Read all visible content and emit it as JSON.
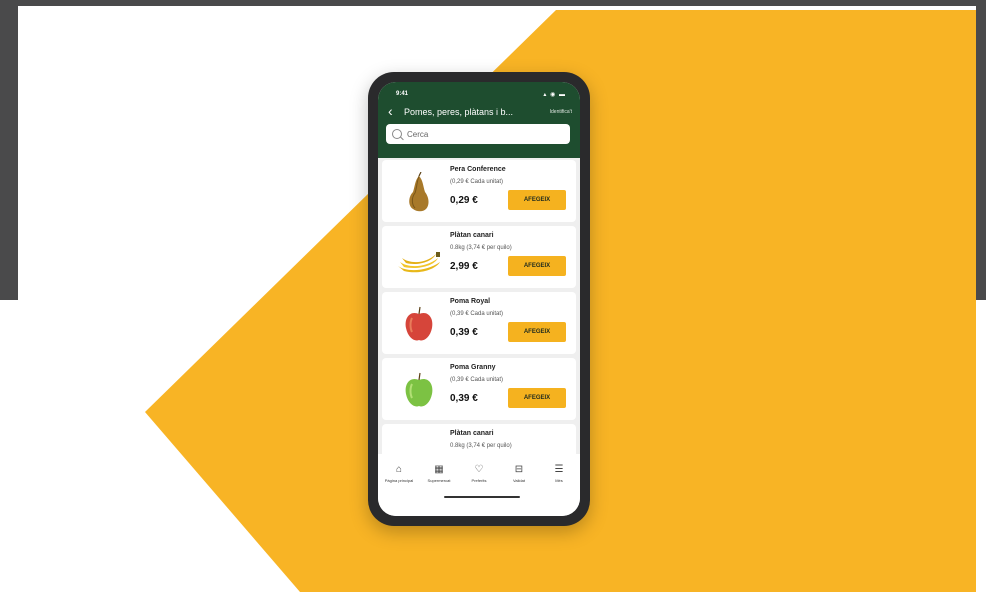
{
  "status_bar": {
    "time": "9:41",
    "icons": "▴ ◉ ▬"
  },
  "header": {
    "back_icon": "‹",
    "title": "Pomes, peres, plàtans i b...",
    "action": "Identifica't"
  },
  "search": {
    "icon": "search-icon",
    "placeholder": "Cerca"
  },
  "products": [
    {
      "name": "Pera Conference",
      "unit": "(0,29 € Cada unitat)",
      "price": "0,29 €",
      "button": "AFEGEIX",
      "image": "pear"
    },
    {
      "name": "Plàtan canari",
      "unit": "0.8kg (3,74 € per quilo)",
      "price": "2,99 €",
      "button": "AFEGEIX",
      "image": "bananas"
    },
    {
      "name": "Poma Royal",
      "unit": "(0,39 € Cada unitat)",
      "price": "0,39 €",
      "button": "AFEGEIX",
      "image": "red-apple"
    },
    {
      "name": "Poma Granny",
      "unit": "(0,39 € Cada unitat)",
      "price": "0,39 €",
      "button": "AFEGEIX",
      "image": "green-apple"
    },
    {
      "name": "Plàtan canari",
      "unit": "0.8kg (3,74 € per quilo)",
      "price": "",
      "button": "",
      "image": "bananas"
    }
  ],
  "tabs": [
    {
      "label": "Pàgina principal",
      "icon": "home-icon"
    },
    {
      "label": "Supermercat",
      "icon": "grid-icon"
    },
    {
      "label": "Preferits",
      "icon": "heart-icon"
    },
    {
      "label": "Validat",
      "icon": "store-icon"
    },
    {
      "label": "Més",
      "icon": "menu-icon"
    }
  ],
  "colors": {
    "brand_green": "#1e4d2f",
    "accent_yellow": "#f5b21f",
    "background_yellow": "#f8b425",
    "frame_gray": "#4a4a4b"
  }
}
